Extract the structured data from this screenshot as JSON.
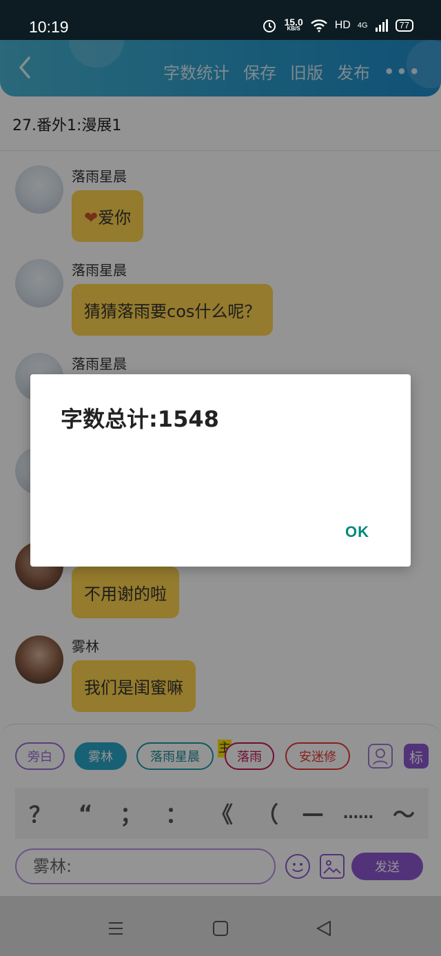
{
  "status_bar": {
    "time": "10:19",
    "net_speed_value": "15.0",
    "net_speed_unit": "KB/S",
    "hd_label": "HD",
    "signal_label": "4G",
    "battery": "77"
  },
  "header": {
    "actions": [
      "字数统计",
      "保存",
      "旧版",
      "发布"
    ],
    "more": "•••"
  },
  "chapter": {
    "title": "27.番外1:漫展1"
  },
  "messages": [
    {
      "sender": "落雨星晨",
      "text": "爱你",
      "prefix_icon": "heart"
    },
    {
      "sender": "落雨星晨",
      "text": "猜猜落雨要cos什么呢？"
    },
    {
      "sender": "落雨星晨",
      "text": ""
    },
    {
      "sender": "",
      "text": ""
    },
    {
      "sender": "",
      "text": "不用谢的啦"
    },
    {
      "sender": "雾林",
      "text": "我们是闺蜜嘛"
    }
  ],
  "panel": {
    "roles": [
      "旁白",
      "雾林",
      "落雨星晨",
      "落雨",
      "安迷修"
    ],
    "host_tag": "主",
    "mark_label": "标",
    "punctuation": [
      "？",
      "“",
      "；",
      "：",
      "《",
      "（",
      "—",
      "……",
      "～"
    ],
    "input_value": "雾林:",
    "send_label": "发送"
  },
  "dialog": {
    "message": "字数总计:1548",
    "ok_label": "OK"
  },
  "colors": {
    "header": "#2a9ccc",
    "bubble": "#ffd54f",
    "accent_purple": "#8e59d1",
    "ok_teal": "#00897b"
  }
}
